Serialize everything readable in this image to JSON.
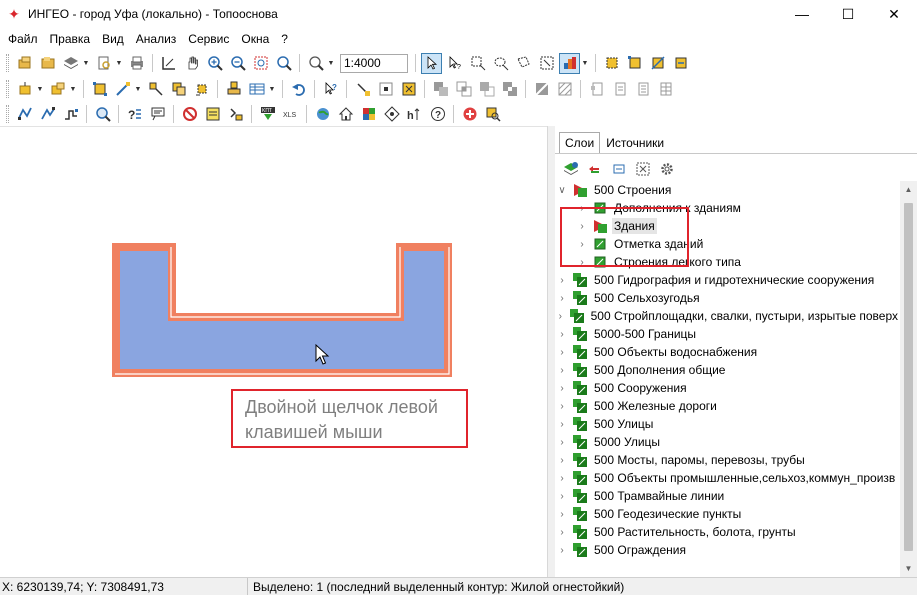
{
  "window": {
    "title": "ИНГЕО - город Уфа (локально) - Топооснова",
    "app_icon": "ingeo-logo-icon",
    "minimize": "—",
    "maximize": "☐",
    "close": "✕"
  },
  "menu": [
    "Файл",
    "Правка",
    "Вид",
    "Анализ",
    "Сервис",
    "Окна",
    "?"
  ],
  "toolbar": {
    "scale_value": "1:4000"
  },
  "map": {
    "tooltip_line1": "Двойной щелчок левой",
    "tooltip_line2": "клавишей мыши",
    "polygon_fill": "#8aa5e0",
    "polygon_outline": "#f08060",
    "highlight_color": "#e0242c"
  },
  "panel": {
    "tabs": [
      "Слои",
      "Источники"
    ],
    "active_tab": "Слои",
    "tree": [
      {
        "label": "500 Строения",
        "expanded": true,
        "level": 0
      },
      {
        "label": "Дополнения к зданиям",
        "level": 1
      },
      {
        "label": "Здания",
        "level": 1,
        "selected": true
      },
      {
        "label": "Отметка зданий",
        "level": 1
      },
      {
        "label": "Строения легкого типа",
        "level": 1
      },
      {
        "label": "500 Гидрография и гидротехнические сооружения",
        "level": 0
      },
      {
        "label": "500 Сельхозугодья",
        "level": 0
      },
      {
        "label": "500 Стройплощадки, свалки, пустыри, изрытые поверх",
        "level": 0
      },
      {
        "label": "5000-500 Границы",
        "level": 0
      },
      {
        "label": "500 Объекты водоснабжения",
        "level": 0
      },
      {
        "label": "500 Дополнения общие",
        "level": 0
      },
      {
        "label": "500 Сооружения",
        "level": 0
      },
      {
        "label": "500 Железные дороги",
        "level": 0
      },
      {
        "label": "500 Улицы",
        "level": 0
      },
      {
        "label": "5000 Улицы",
        "level": 0
      },
      {
        "label": "500 Мосты, паромы, перевозы, трубы",
        "level": 0
      },
      {
        "label": "500 Объекты промышленные,сельхоз,коммун_произв",
        "level": 0
      },
      {
        "label": "500 Трамвайные линии",
        "level": 0
      },
      {
        "label": "500 Геодезические пункты",
        "level": 0
      },
      {
        "label": "500 Растительность, болота, грунты",
        "level": 0
      },
      {
        "label": "500 Ограждения",
        "level": 0
      }
    ]
  },
  "status": {
    "coords": "X: 6230139,74; Y: 7308491,73",
    "selection": "Выделено: 1 (последний выделенный контур: Жилой огнестойкий)"
  }
}
